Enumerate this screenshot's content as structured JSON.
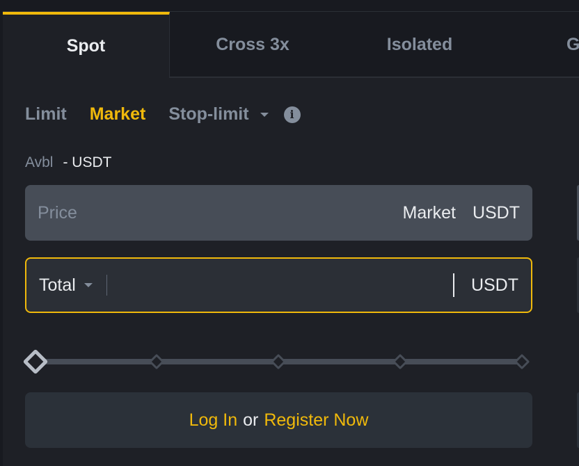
{
  "tabs": [
    {
      "label": "Spot",
      "active": true
    },
    {
      "label": "Cross 3x"
    },
    {
      "label": "Isolated"
    },
    {
      "label": "G"
    }
  ],
  "order_types": {
    "limit": "Limit",
    "market": "Market",
    "stop_limit": "Stop-limit",
    "active": "Market"
  },
  "avbl": {
    "label": "Avbl",
    "value": "- USDT"
  },
  "price": {
    "placeholder": "Price",
    "mode": "Market",
    "unit": "USDT"
  },
  "total": {
    "label": "Total",
    "value": "",
    "unit": "USDT"
  },
  "slider": {
    "percent": 0,
    "steps": [
      0,
      25,
      50,
      75,
      100
    ]
  },
  "login": {
    "login": "Log In",
    "or": "or",
    "register": "Register Now"
  },
  "colors": {
    "accent": "#f0b90b",
    "background": "#1e2026",
    "input": "#474d57"
  }
}
